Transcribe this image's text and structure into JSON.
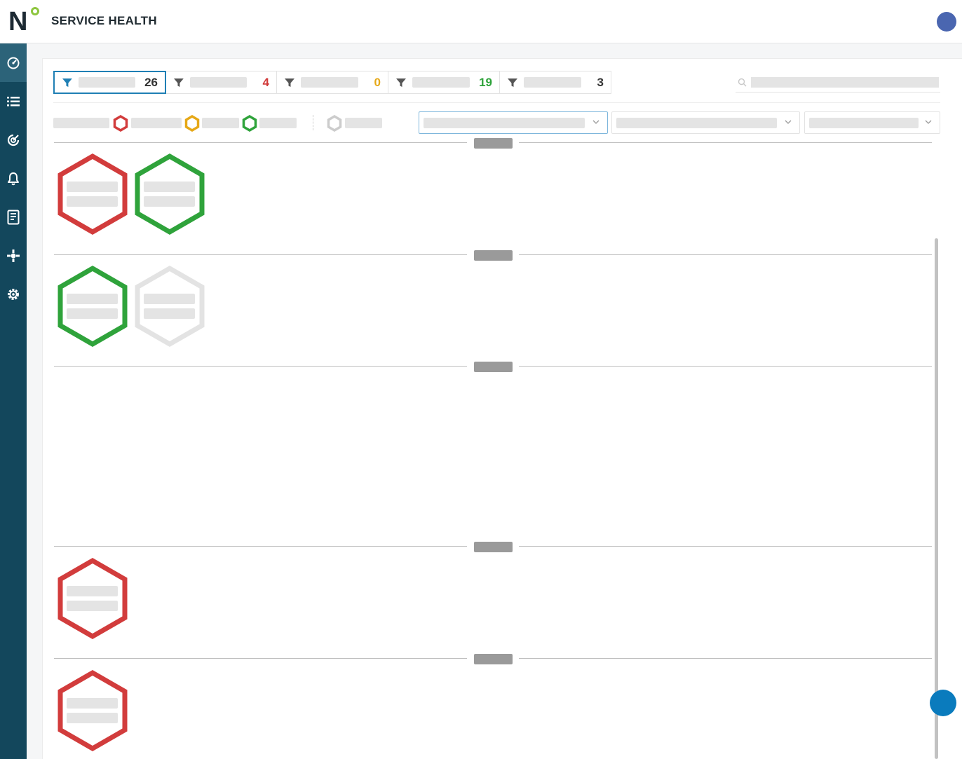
{
  "app": {
    "title": "SERVICE HEALTH",
    "logo_letter": "N",
    "brand_green": "#8ec63f",
    "sidebar_color": "#13475c"
  },
  "sidebar": {
    "items": [
      {
        "icon": "dashboard-icon",
        "active": true
      },
      {
        "icon": "list-icon",
        "active": false
      },
      {
        "icon": "target-icon",
        "active": false
      },
      {
        "icon": "bell-icon",
        "active": false
      },
      {
        "icon": "report-icon",
        "active": false
      },
      {
        "icon": "cog-network-icon",
        "active": false
      },
      {
        "icon": "settings-icon",
        "active": false
      }
    ]
  },
  "filters": {
    "chips": [
      {
        "count": "26",
        "color": "#333333",
        "icon_color": "#1f7fb4",
        "selected": true
      },
      {
        "count": "4",
        "color": "#d13b3b",
        "icon_color": "#555555",
        "selected": false
      },
      {
        "count": "0",
        "color": "#e6a817",
        "icon_color": "#555555",
        "selected": false
      },
      {
        "count": "19",
        "color": "#2fa33b",
        "icon_color": "#555555",
        "selected": false
      },
      {
        "count": "3",
        "color": "#333333",
        "icon_color": "#555555",
        "selected": false
      }
    ]
  },
  "status_colors": {
    "critical": "#d23c3c",
    "warning": "#e6a817",
    "ok": "#2fa33b",
    "unknown": "#e3e3e3"
  }
}
